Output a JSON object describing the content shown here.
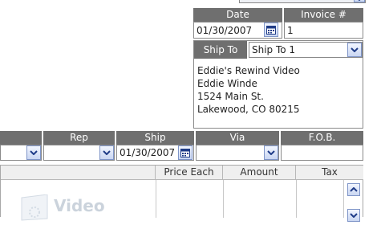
{
  "top_combo": {
    "value": "..."
  },
  "invoice_header": {
    "date_label": "Date",
    "date_value": "01/30/2007",
    "invoice_label": "Invoice #",
    "invoice_value": "1"
  },
  "ship_to": {
    "label": "Ship To",
    "selected": "Ship To 1",
    "address_lines": [
      "Eddie's Rewind Video",
      "Eddie Winde",
      "1524 Main St.",
      "Lakewood, CO 80215"
    ]
  },
  "terms_row": {
    "rep_label": "Rep",
    "ship_label": "Ship",
    "ship_value": "01/30/2007",
    "via_label": "Via",
    "fob_label": "F.O.B."
  },
  "line_items": {
    "columns": [
      "Price Each",
      "Amount",
      "Tax"
    ]
  },
  "watermark": {
    "text": "Video"
  },
  "colors": {
    "header_bg": "#6f6f6f",
    "button_blue": "#c9d6f2",
    "icon_blue": "#1f3c88"
  }
}
